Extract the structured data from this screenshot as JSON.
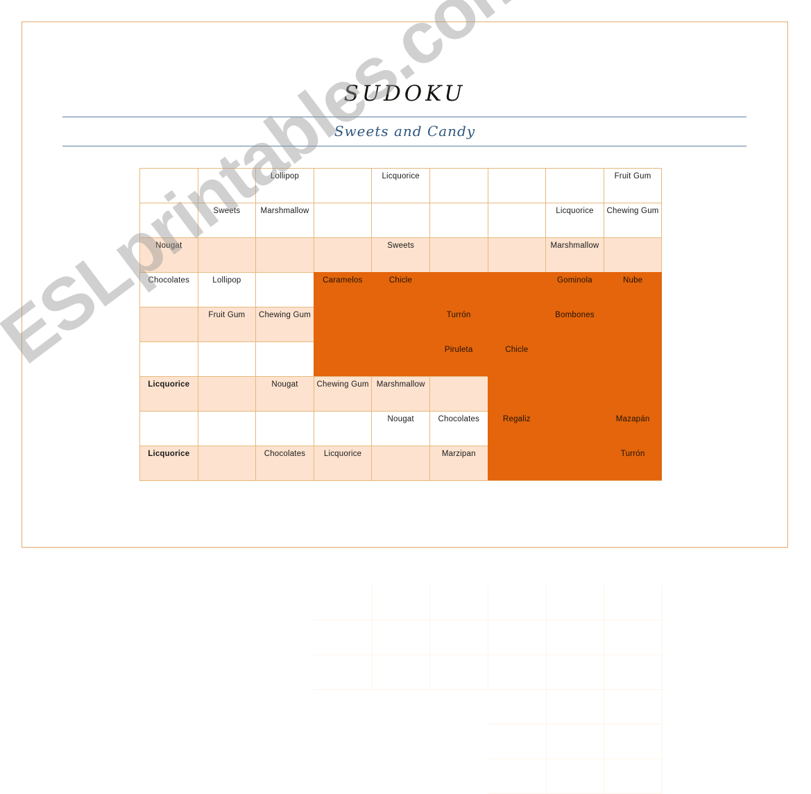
{
  "document": {
    "title": "SUDOKU",
    "subtitle": "Sweets and Candy",
    "watermark": "ESLprintables.com"
  },
  "grid": {
    "rows": 9,
    "columns": 9,
    "shaded_rows": [
      2,
      4,
      6,
      8
    ],
    "colors": {
      "cell_border": "#e8b77c",
      "shade": "#fde3cf",
      "overlay": "#e4650b",
      "frame": "#e2a96a",
      "rule": "#5b7ea3",
      "subtitle_text": "#30567e"
    },
    "cells": [
      [
        {
          "text": "",
          "bold": false,
          "overlay": false
        },
        {
          "text": "",
          "bold": false,
          "overlay": false
        },
        {
          "text": "Lollipop",
          "bold": false,
          "overlay": false
        },
        {
          "text": "",
          "bold": false,
          "overlay": false
        },
        {
          "text": "Licquorice",
          "bold": false,
          "overlay": false
        },
        {
          "text": "",
          "bold": false,
          "overlay": false
        },
        {
          "text": "",
          "bold": false,
          "overlay": false
        },
        {
          "text": "",
          "bold": false,
          "overlay": false
        },
        {
          "text": "Fruit Gum",
          "bold": false,
          "overlay": false
        }
      ],
      [
        {
          "text": "",
          "bold": false,
          "overlay": false
        },
        {
          "text": "Sweets",
          "bold": false,
          "overlay": false
        },
        {
          "text": "Marshmallow",
          "bold": false,
          "overlay": false
        },
        {
          "text": "",
          "bold": false,
          "overlay": false
        },
        {
          "text": "",
          "bold": false,
          "overlay": false
        },
        {
          "text": "",
          "bold": false,
          "overlay": false
        },
        {
          "text": "",
          "bold": false,
          "overlay": false
        },
        {
          "text": "Licquorice",
          "bold": false,
          "overlay": false
        },
        {
          "text": "Chewing Gum",
          "bold": false,
          "overlay": false
        }
      ],
      [
        {
          "text": "Nougat",
          "bold": false,
          "overlay": false
        },
        {
          "text": "",
          "bold": false,
          "overlay": false
        },
        {
          "text": "",
          "bold": false,
          "overlay": false
        },
        {
          "text": "",
          "bold": false,
          "overlay": false
        },
        {
          "text": "Sweets",
          "bold": false,
          "overlay": false
        },
        {
          "text": "",
          "bold": false,
          "overlay": false
        },
        {
          "text": "",
          "bold": false,
          "overlay": false
        },
        {
          "text": "Marshmallow",
          "bold": false,
          "overlay": false
        },
        {
          "text": "",
          "bold": false,
          "overlay": false
        }
      ],
      [
        {
          "text": "Chocolates",
          "bold": false,
          "overlay": false
        },
        {
          "text": "Lollipop",
          "bold": false,
          "overlay": false
        },
        {
          "text": "",
          "bold": false,
          "overlay": false
        },
        {
          "text": "Caramelos",
          "bold": false,
          "overlay": true
        },
        {
          "text": "Chicle",
          "bold": false,
          "overlay": true
        },
        {
          "text": "",
          "bold": false,
          "overlay": true
        },
        {
          "text": "",
          "bold": false,
          "overlay": true
        },
        {
          "text": "Gominola",
          "bold": false,
          "overlay": true
        },
        {
          "text": "Nube",
          "bold": false,
          "overlay": true
        }
      ],
      [
        {
          "text": "",
          "bold": false,
          "overlay": false
        },
        {
          "text": "Fruit Gum",
          "bold": false,
          "overlay": false
        },
        {
          "text": "Chewing Gum",
          "bold": false,
          "overlay": false
        },
        {
          "text": "",
          "bold": false,
          "overlay": true
        },
        {
          "text": "",
          "bold": false,
          "overlay": true
        },
        {
          "text": "Turrón",
          "bold": false,
          "overlay": true
        },
        {
          "text": "",
          "bold": false,
          "overlay": true
        },
        {
          "text": "Bombones",
          "bold": false,
          "overlay": true
        },
        {
          "text": "",
          "bold": false,
          "overlay": true
        }
      ],
      [
        {
          "text": "",
          "bold": false,
          "overlay": false
        },
        {
          "text": "",
          "bold": false,
          "overlay": false
        },
        {
          "text": "",
          "bold": false,
          "overlay": false
        },
        {
          "text": "",
          "bold": false,
          "overlay": true
        },
        {
          "text": "",
          "bold": false,
          "overlay": true
        },
        {
          "text": "Piruleta",
          "bold": false,
          "overlay": true
        },
        {
          "text": "Chicle",
          "bold": false,
          "overlay": true
        },
        {
          "text": "",
          "bold": false,
          "overlay": true
        },
        {
          "text": "",
          "bold": false,
          "overlay": true
        }
      ],
      [
        {
          "text": "Licquorice",
          "bold": true,
          "overlay": false
        },
        {
          "text": "",
          "bold": false,
          "overlay": false
        },
        {
          "text": "Nougat",
          "bold": false,
          "overlay": false
        },
        {
          "text": "Chewing Gum",
          "bold": false,
          "overlay": false
        },
        {
          "text": "Marshmallow",
          "bold": false,
          "overlay": false
        },
        {
          "text": "",
          "bold": false,
          "overlay": false
        },
        {
          "text": "",
          "bold": false,
          "overlay": true
        },
        {
          "text": "",
          "bold": false,
          "overlay": true
        },
        {
          "text": "",
          "bold": false,
          "overlay": true
        }
      ],
      [
        {
          "text": "",
          "bold": false,
          "overlay": false
        },
        {
          "text": "",
          "bold": false,
          "overlay": false
        },
        {
          "text": "",
          "bold": false,
          "overlay": false
        },
        {
          "text": "",
          "bold": false,
          "overlay": false
        },
        {
          "text": "Nougat",
          "bold": false,
          "overlay": false
        },
        {
          "text": "Chocolates",
          "bold": false,
          "overlay": false
        },
        {
          "text": "Regaliz",
          "bold": false,
          "overlay": true
        },
        {
          "text": "",
          "bold": false,
          "overlay": true
        },
        {
          "text": "Mazapán",
          "bold": false,
          "overlay": true
        }
      ],
      [
        {
          "text": "Licquorice",
          "bold": true,
          "overlay": false
        },
        {
          "text": "",
          "bold": false,
          "overlay": false
        },
        {
          "text": "Chocolates",
          "bold": false,
          "overlay": false
        },
        {
          "text": "Licquorice",
          "bold": false,
          "overlay": false
        },
        {
          "text": "",
          "bold": false,
          "overlay": false
        },
        {
          "text": "Marzipan",
          "bold": false,
          "overlay": false
        },
        {
          "text": "",
          "bold": false,
          "overlay": true
        },
        {
          "text": "",
          "bold": false,
          "overlay": true
        },
        {
          "text": "Turrón",
          "bold": false,
          "overlay": true
        }
      ]
    ]
  }
}
